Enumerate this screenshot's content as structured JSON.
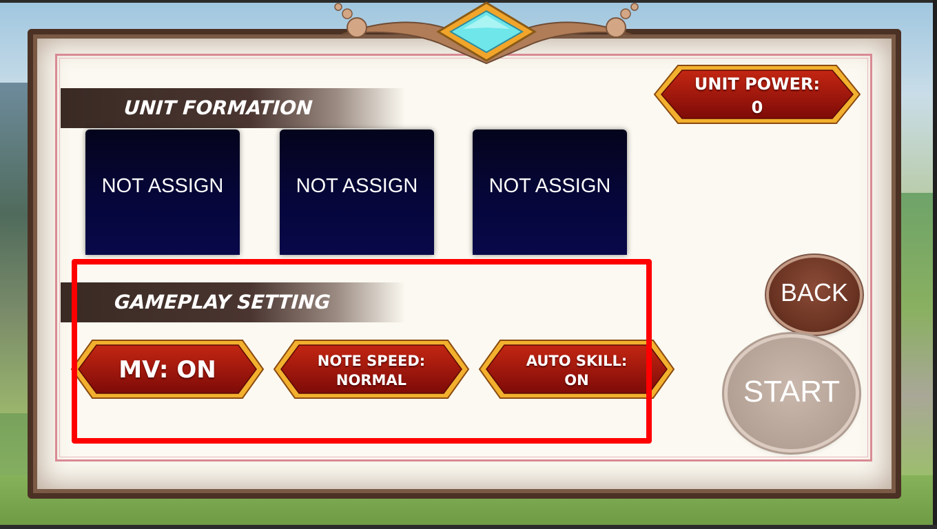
{
  "formation": {
    "title": "UNIT FORMATION",
    "slots": [
      "NOT ASSIGN",
      "NOT ASSIGN",
      "NOT ASSIGN"
    ]
  },
  "unit_power": {
    "label": "UNIT POWER:",
    "value": "0"
  },
  "gameplay": {
    "title": "GAMEPLAY SETTING",
    "mv": "MV: ON",
    "note_speed": {
      "label": "NOTE SPEED:",
      "value": "NORMAL"
    },
    "auto_skill": {
      "label": "AUTO SKILL:",
      "value": "ON"
    }
  },
  "buttons": {
    "back": "BACK",
    "start": "START"
  },
  "colors": {
    "button_red": "#a4140d",
    "button_gold": "#f2b02e",
    "slot_navy": "#06063a",
    "highlight": "#ff0000"
  }
}
